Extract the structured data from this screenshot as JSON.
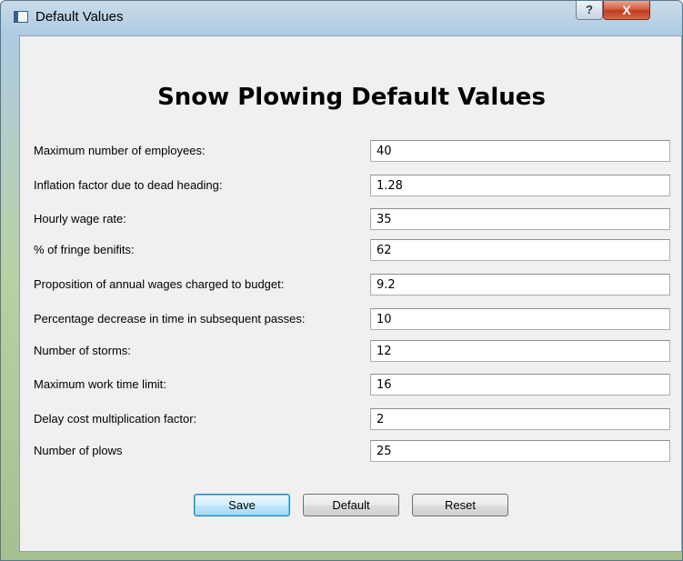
{
  "window": {
    "title": "Default Values",
    "help_glyph": "?",
    "close_glyph": "X"
  },
  "heading": "Snow Plowing Default Values",
  "fields": [
    {
      "label": "Maximum number of employees:",
      "value": "40"
    },
    {
      "label": "Inflation factor due to dead heading:",
      "value": "1.28"
    },
    {
      "label": "Hourly wage rate:",
      "value": "35"
    },
    {
      "label": "% of fringe benifits:",
      "value": "62"
    },
    {
      "label": "Proposition of annual wages charged to budget:",
      "value": "9.2"
    },
    {
      "label": "Percentage decrease in time in subsequent passes:",
      "value": "10"
    },
    {
      "label": "Number of storms:",
      "value": "12"
    },
    {
      "label": "Maximum work time limit:",
      "value": "16"
    },
    {
      "label": "Delay cost multiplication factor:",
      "value": "2"
    },
    {
      "label": "Number of plows",
      "value": "25"
    }
  ],
  "buttons": {
    "save": "Save",
    "default": "Default",
    "reset": "Reset"
  }
}
